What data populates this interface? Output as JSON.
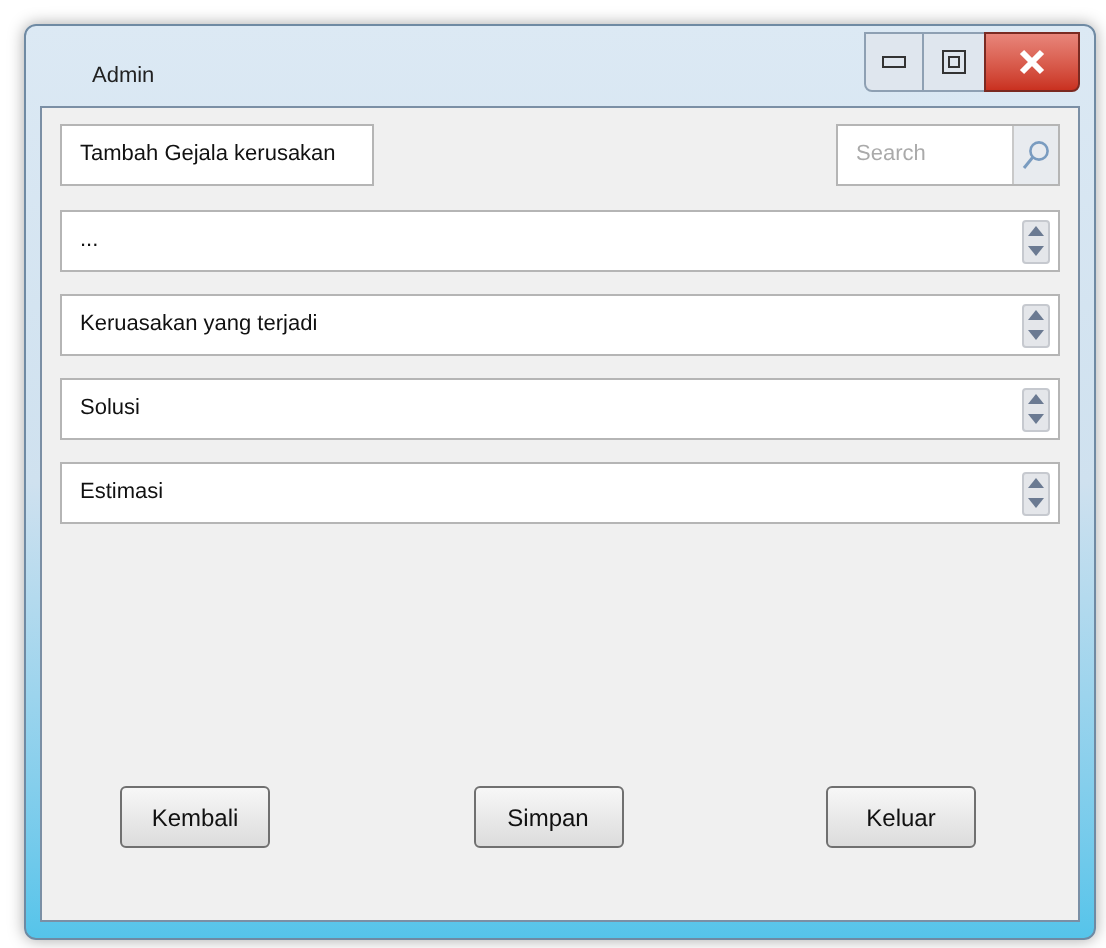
{
  "window": {
    "title": "Admin"
  },
  "header": {
    "title_field": {
      "value": "Tambah Gejala kerusakan"
    },
    "search": {
      "placeholder": "Search"
    }
  },
  "fields": [
    {
      "value": "..."
    },
    {
      "value": "Keruasakan yang terjadi"
    },
    {
      "value": "Solusi"
    },
    {
      "value": "Estimasi"
    }
  ],
  "buttons": [
    {
      "label": "Kembali"
    },
    {
      "label": "Simpan"
    },
    {
      "label": "Keluar"
    }
  ]
}
